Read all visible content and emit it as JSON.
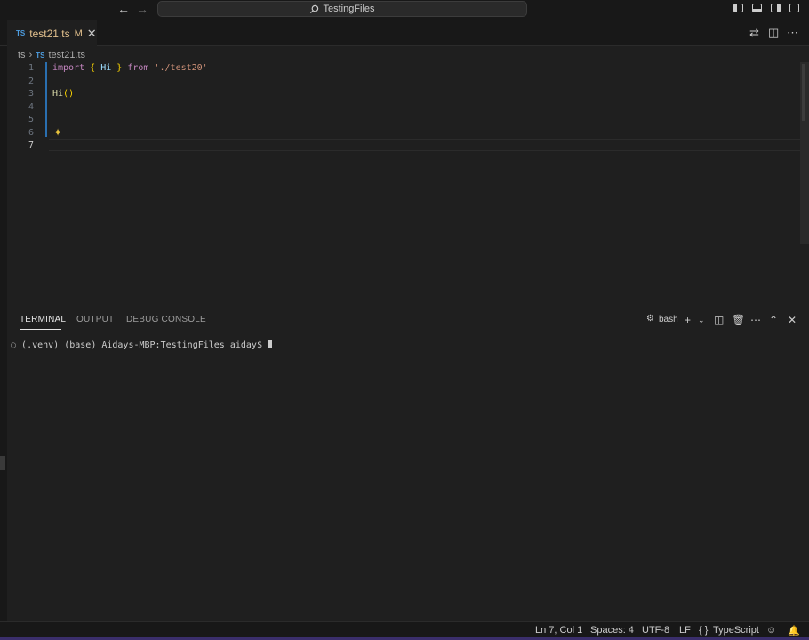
{
  "titlebar": {
    "search_label": "TestingFiles",
    "icons": [
      "arrow-left-icon",
      "arrow-right-icon",
      "search-icon",
      "toggle-primary-sidebar-icon",
      "toggle-panel-icon",
      "toggle-secondary-sidebar-icon",
      "customize-layout-icon"
    ]
  },
  "tabs": {
    "active": {
      "badge": "TS",
      "label": "test21.ts",
      "status": "M",
      "close": "✕"
    },
    "actions": [
      "open-changes-icon",
      "split-editor-icon",
      "more-actions-icon"
    ]
  },
  "breadcrumb": {
    "folder": "ts",
    "file_badge": "TS",
    "file": "test21.ts"
  },
  "editor": {
    "lines": [
      {
        "number": "1",
        "tokens": [
          {
            "t": "import",
            "c": "kw"
          },
          {
            "t": " "
          },
          {
            "t": "{",
            "c": "br"
          },
          {
            "t": " "
          },
          {
            "t": "Hi",
            "c": "id"
          },
          {
            "t": " "
          },
          {
            "t": "}",
            "c": "br"
          },
          {
            "t": " "
          },
          {
            "t": "from",
            "c": "kw"
          },
          {
            "t": " "
          },
          {
            "t": "'./test20'",
            "c": "str"
          }
        ]
      },
      {
        "number": "2",
        "tokens": []
      },
      {
        "number": "3",
        "tokens": [
          {
            "t": "Hi",
            "c": "fn"
          },
          {
            "t": "()",
            "c": "br"
          }
        ]
      },
      {
        "number": "4",
        "tokens": []
      },
      {
        "number": "5",
        "tokens": []
      },
      {
        "number": "6",
        "tokens": []
      },
      {
        "number": "7",
        "tokens": [],
        "active": true
      }
    ],
    "sparkle_icon": "copilot-sparkle-icon"
  },
  "panel": {
    "tabs": [
      "TERMINAL",
      "OUTPUT",
      "DEBUG CONSOLE"
    ],
    "active_tab": "TERMINAL",
    "terminal_name": "bash",
    "prompt": "(.venv) (base) Aidays-MBP:TestingFiles aiday$ "
  },
  "statusbar": {
    "position": "Ln 7, Col 1",
    "spaces": "Spaces: 4",
    "encoding": "UTF-8",
    "eol": "LF",
    "language_braces": "{ }",
    "language": "TypeScript"
  },
  "colors": {
    "accent": "#0078d4",
    "modified": "#e2c08d",
    "background": "#1f1f1f"
  }
}
